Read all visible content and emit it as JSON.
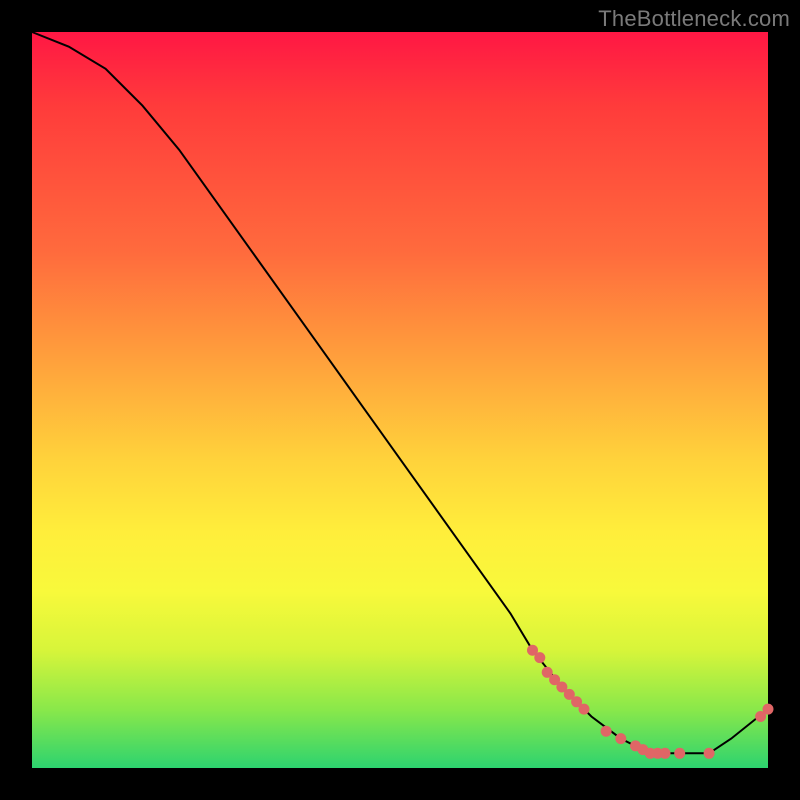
{
  "watermark": "TheBottleneck.com",
  "colors": {
    "gradient_top": "#ff1744",
    "gradient_mid": "#ffee3b",
    "gradient_bottom": "#2dd36f",
    "line": "#000000",
    "marker": "#e06666",
    "background": "#000000",
    "watermark_text": "#7a7a7a"
  },
  "chart_data": {
    "type": "line",
    "title": "",
    "xlabel": "",
    "ylabel": "",
    "xlim": [
      0,
      100
    ],
    "ylim": [
      0,
      100
    ],
    "series": [
      {
        "name": "curve",
        "x": [
          0,
          5,
          10,
          15,
          20,
          25,
          30,
          35,
          40,
          45,
          50,
          55,
          60,
          65,
          68,
          72,
          76,
          80,
          84,
          88,
          92,
          95,
          100
        ],
        "y": [
          100,
          98,
          95,
          90,
          84,
          77,
          70,
          63,
          56,
          49,
          42,
          35,
          28,
          21,
          16,
          11,
          7,
          4,
          2,
          2,
          2,
          4,
          8
        ]
      }
    ],
    "markers": [
      {
        "x": 68,
        "y": 16
      },
      {
        "x": 69,
        "y": 15
      },
      {
        "x": 70,
        "y": 13
      },
      {
        "x": 71,
        "y": 12
      },
      {
        "x": 72,
        "y": 11
      },
      {
        "x": 73,
        "y": 10
      },
      {
        "x": 74,
        "y": 9
      },
      {
        "x": 75,
        "y": 8
      },
      {
        "x": 78,
        "y": 5
      },
      {
        "x": 80,
        "y": 4
      },
      {
        "x": 82,
        "y": 3
      },
      {
        "x": 83,
        "y": 2.5
      },
      {
        "x": 84,
        "y": 2
      },
      {
        "x": 85,
        "y": 2
      },
      {
        "x": 86,
        "y": 2
      },
      {
        "x": 88,
        "y": 2
      },
      {
        "x": 92,
        "y": 2
      },
      {
        "x": 99,
        "y": 7
      },
      {
        "x": 100,
        "y": 8
      }
    ]
  }
}
